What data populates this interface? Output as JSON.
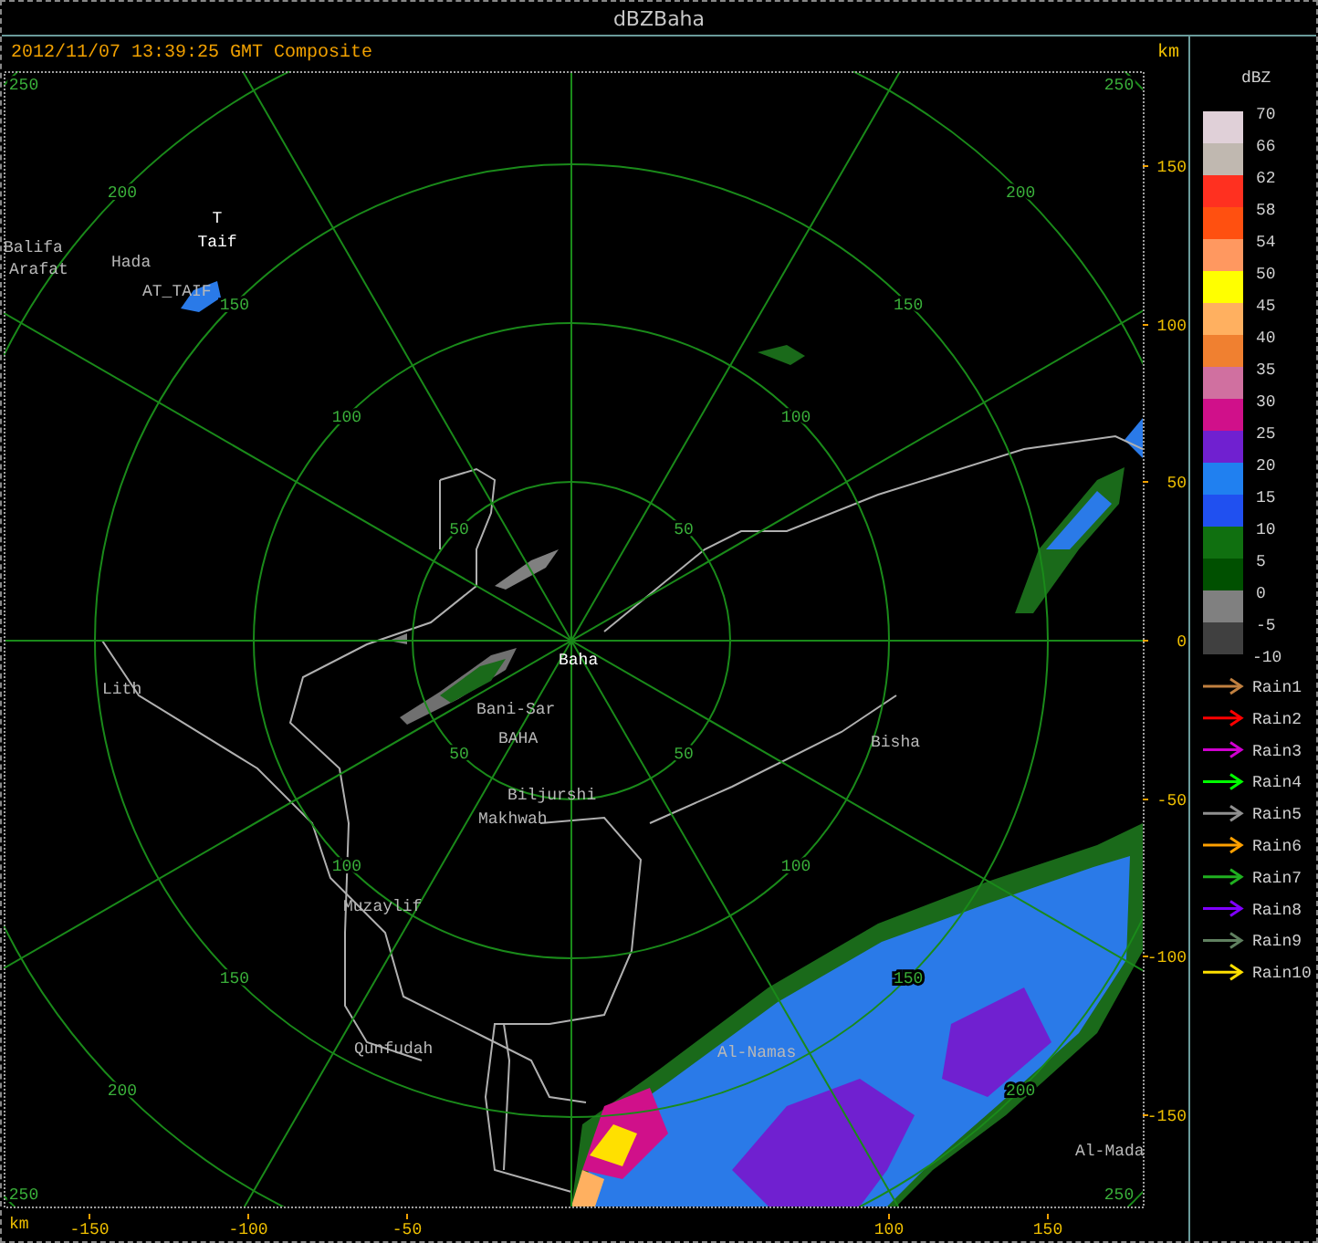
{
  "window": {
    "title": "dBZBaha"
  },
  "header": {
    "timestamp": "2012/11/07 13:39:25 GMT Composite",
    "unit": "km"
  },
  "plot": {
    "range_rings": [
      {
        "labels": [
          "50",
          "50",
          "50",
          "50"
        ]
      },
      {
        "labels": [
          "100",
          "100",
          "100",
          "100"
        ]
      },
      {
        "labels": [
          "150",
          "150",
          "150",
          "150"
        ]
      },
      {
        "labels": [
          "200",
          "200",
          "200",
          "200"
        ]
      },
      {
        "labels": [
          "250",
          "250",
          "250",
          "250"
        ]
      }
    ],
    "places": [
      {
        "name": "T",
        "highlighted": true
      },
      {
        "name": "Taif",
        "highlighted": true
      },
      {
        "name": "Balifa",
        "highlighted": false
      },
      {
        "name": "Arafat",
        "highlighted": false
      },
      {
        "name": "Hada",
        "highlighted": false
      },
      {
        "name": "AT_TAIF",
        "highlighted": false
      },
      {
        "name": "Baha",
        "highlighted": true
      },
      {
        "name": "Bani-Sar",
        "highlighted": false
      },
      {
        "name": "BAHA",
        "highlighted": false
      },
      {
        "name": "Biljurshi",
        "highlighted": false
      },
      {
        "name": "Makhwah",
        "highlighted": false
      },
      {
        "name": "Lith",
        "highlighted": false
      },
      {
        "name": "Muzaylif",
        "highlighted": false
      },
      {
        "name": "Qunfudah",
        "highlighted": false
      },
      {
        "name": "Al-Namas",
        "highlighted": false
      },
      {
        "name": "Al-Mada",
        "highlighted": false
      },
      {
        "name": "Bisha",
        "highlighted": false
      }
    ],
    "x_axis": {
      "unit": "km",
      "ticks": [
        "-150",
        "-100",
        "-50",
        "100",
        "150"
      ]
    },
    "y_axis": {
      "ticks": [
        "150",
        "100",
        "50",
        "0",
        "-50",
        "-100",
        "-150"
      ]
    }
  },
  "legend": {
    "unit": "dBZ",
    "scale": [
      {
        "label": "70",
        "color": "#e0d0d8"
      },
      {
        "label": "66",
        "color": "#c0b8b0"
      },
      {
        "label": "62",
        "color": "#ff3020"
      },
      {
        "label": "58",
        "color": "#ff5010"
      },
      {
        "label": "54",
        "color": "#ff9860"
      },
      {
        "label": "50",
        "color": "#ffff00"
      },
      {
        "label": "45",
        "color": "#ffb060"
      },
      {
        "label": "40",
        "color": "#f08030"
      },
      {
        "label": "35",
        "color": "#d070a0"
      },
      {
        "label": "30",
        "color": "#d0108a"
      },
      {
        "label": "25",
        "color": "#7020d0"
      },
      {
        "label": "20",
        "color": "#2080f0"
      },
      {
        "label": "15",
        "color": "#2050f0"
      },
      {
        "label": "10",
        "color": "#107010"
      },
      {
        "label": "5",
        "color": "#005000"
      },
      {
        "label": "0",
        "color": "#808080"
      },
      {
        "label": "-5",
        "color": "#404040"
      }
    ],
    "bottom_label": "-10",
    "rain_series": [
      {
        "label": "Rain1",
        "color": "#c08040"
      },
      {
        "label": "Rain2",
        "color": "#ff0000"
      },
      {
        "label": "Rain3",
        "color": "#d000d0"
      },
      {
        "label": "Rain4",
        "color": "#00ff00"
      },
      {
        "label": "Rain5",
        "color": "#909090"
      },
      {
        "label": "Rain6",
        "color": "#ffa000"
      },
      {
        "label": "Rain7",
        "color": "#20b020"
      },
      {
        "label": "Rain8",
        "color": "#8000ff"
      },
      {
        "label": "Rain9",
        "color": "#608060"
      },
      {
        "label": "Rain10",
        "color": "#ffe000"
      }
    ]
  }
}
